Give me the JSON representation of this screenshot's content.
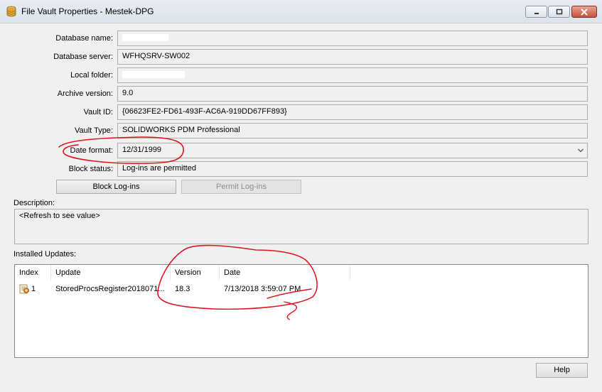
{
  "window": {
    "title": "File Vault Properties - Mestek-DPG"
  },
  "fields": [
    {
      "label": "Database name:",
      "value": ""
    },
    {
      "label": "Database server:",
      "value": "WFHQSRV-SW002"
    },
    {
      "label": "Local folder:",
      "value": ""
    },
    {
      "label": "Archive version:",
      "value": "9.0"
    },
    {
      "label": "Vault ID:",
      "value": "{06623FE2-FD61-493F-AC6A-919DD67FF893}"
    },
    {
      "label": "Vault Type:",
      "value": "SOLIDWORKS PDM Professional"
    },
    {
      "label": "Date format:",
      "value": "12/31/1999"
    },
    {
      "label": "Block status:",
      "value": "Log-ins are permitted"
    }
  ],
  "buttons": {
    "block_logins": "Block Log-ins",
    "permit_logins": "Permit Log-ins",
    "help": "Help"
  },
  "description": {
    "label": "Description:",
    "value": "<Refresh to see value>"
  },
  "updates": {
    "label": "Installed Updates:",
    "columns": [
      "Index",
      "Update",
      "Version",
      "Date"
    ],
    "rows": [
      {
        "index": "1",
        "update": "StoredProcsRegister2018071...",
        "version": "18.3",
        "date": "7/13/2018 3:59:07 PM"
      }
    ]
  },
  "colors": {
    "annotation_red": "#e0141e",
    "window_bg": "#f0f0f0",
    "close_button": "#c8503b"
  },
  "icons": {
    "app": "database-icon",
    "row": "package-update-icon",
    "dropdown": "chevron-down-icon"
  }
}
